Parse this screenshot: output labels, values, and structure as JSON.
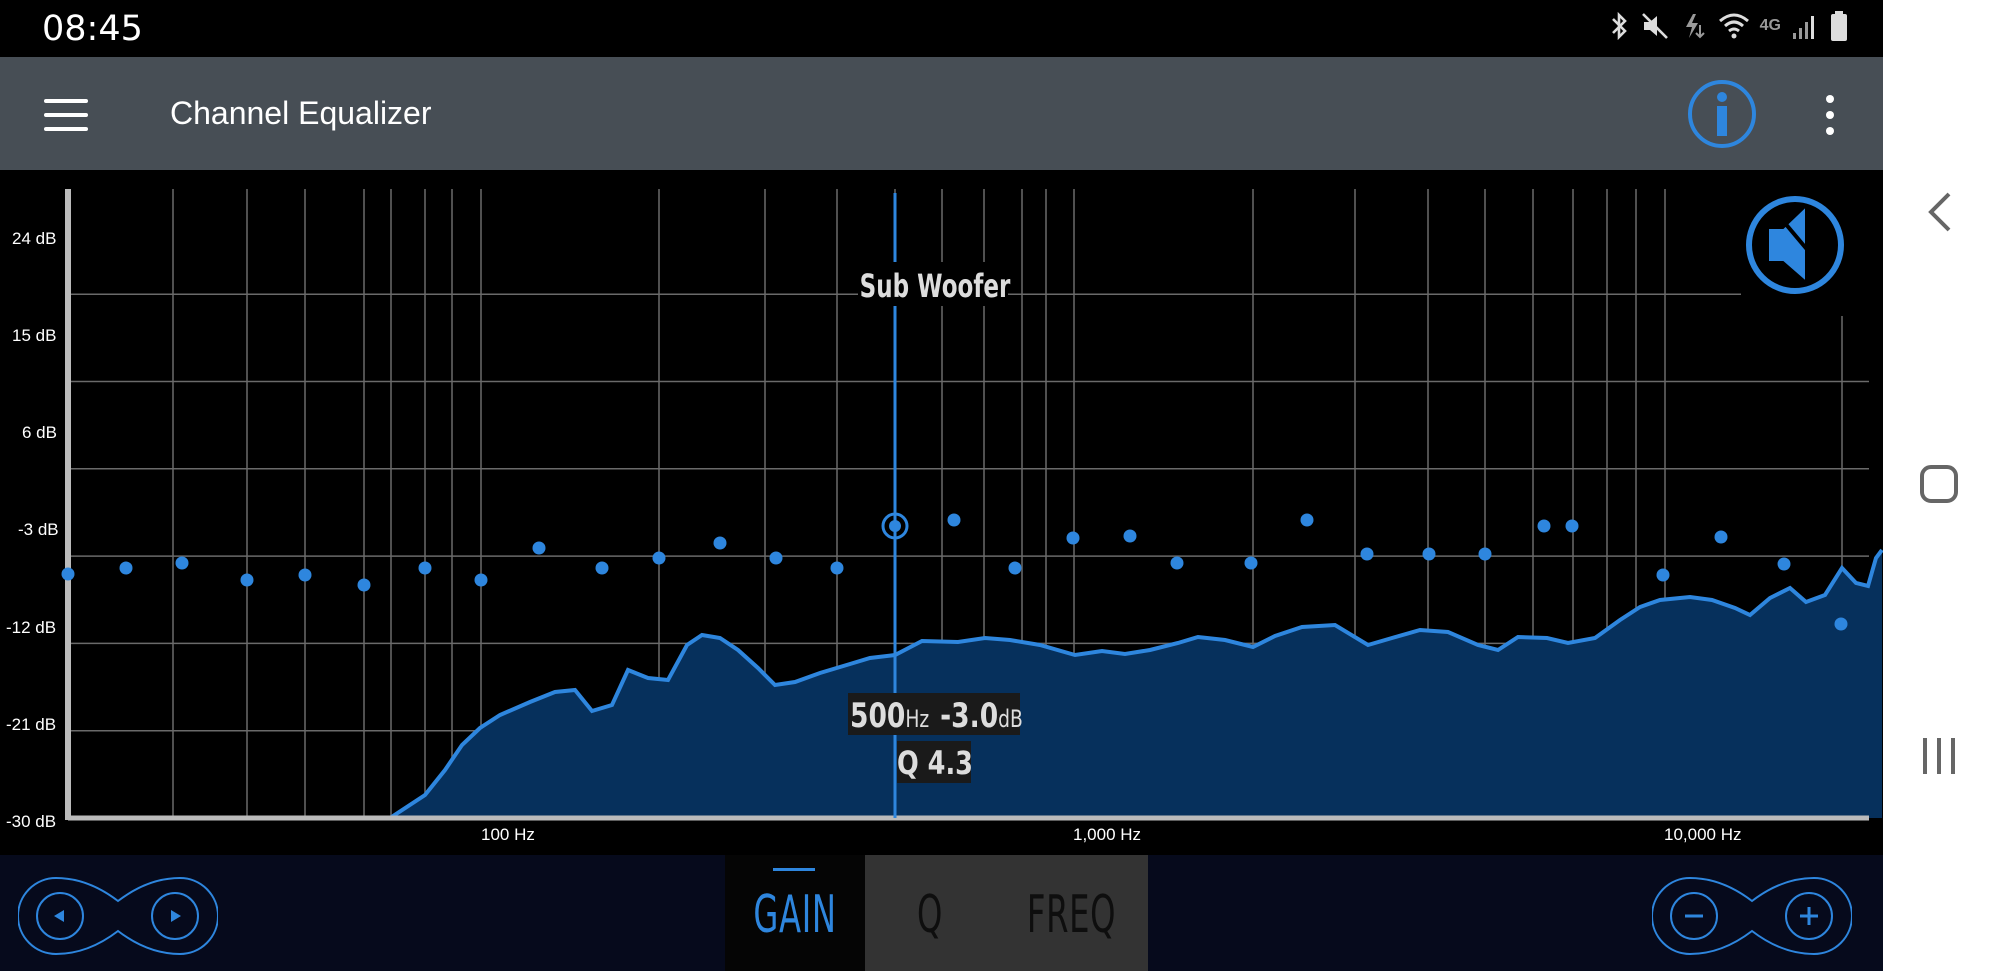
{
  "status_bar": {
    "time": "08:45",
    "icons": [
      "bluetooth-icon",
      "mute-icon",
      "data-icon",
      "wifi-icon",
      "4g-icon",
      "signal-icon",
      "battery-icon"
    ],
    "network_label": "4G"
  },
  "app_bar": {
    "title": "Channel Equalizer",
    "icons": [
      "menu-icon",
      "info-icon",
      "more-vert-icon"
    ]
  },
  "equalizer": {
    "y_labels": [
      "24 dB",
      "15 dB",
      "6 dB",
      "-3 dB",
      "-12 dB",
      "-21 dB",
      "-30 dB"
    ],
    "x_labels": [
      "100 Hz",
      "1,000 Hz",
      "10,000 Hz"
    ],
    "channel_label": "Sub Woofer",
    "selected_freq": "500",
    "selected_freq_unit": "Hz",
    "selected_gain": "-3.0",
    "selected_gain_unit": "dB",
    "selected_q": "Q 4.3",
    "mute_icon": "speaker-mute-icon",
    "accent_color": "#2e86de",
    "fill_color": "#06305c"
  },
  "bottom_bar": {
    "tabs": [
      {
        "label": "GAIN",
        "active": true
      },
      {
        "label": "Q",
        "active": false
      },
      {
        "label": "FREQ",
        "active": false
      }
    ],
    "left_pill_icons": [
      "prev-band-icon",
      "next-band-icon"
    ],
    "right_pill_icons": [
      "minus-icon",
      "plus-icon"
    ]
  },
  "system_nav": {
    "icons": [
      "back-icon",
      "home-icon",
      "recents-icon"
    ]
  }
}
